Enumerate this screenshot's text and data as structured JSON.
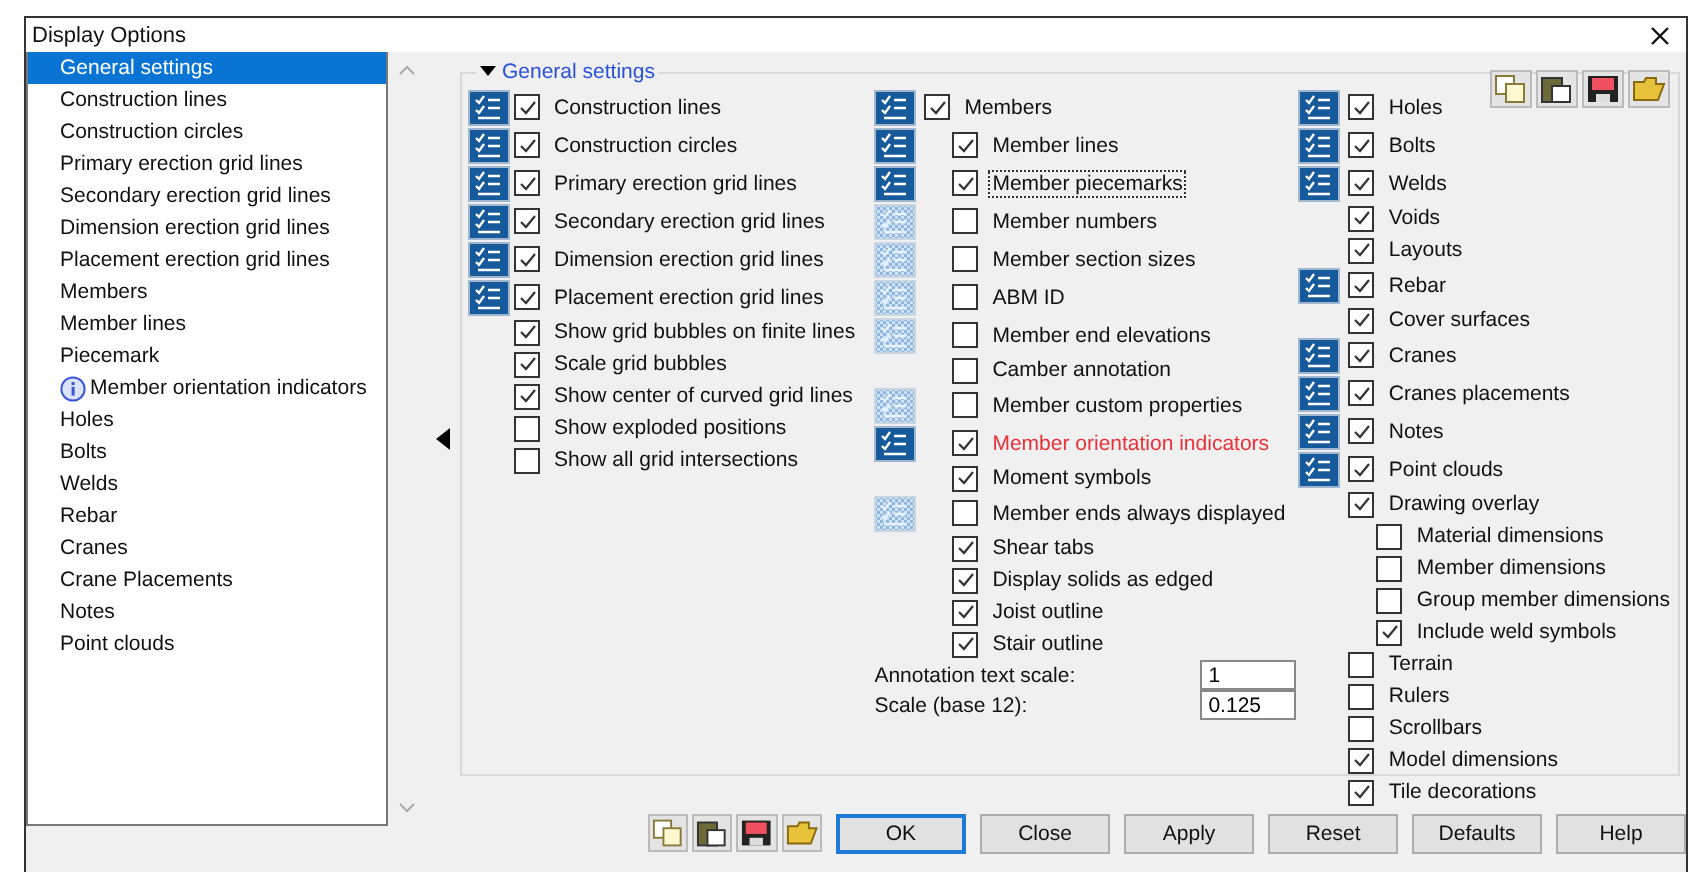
{
  "window": {
    "title": "Display Options"
  },
  "sidebar": {
    "items": [
      {
        "label": "General settings",
        "selected": true,
        "kind": "plain"
      },
      {
        "label": "Construction lines",
        "selected": false,
        "kind": "plain"
      },
      {
        "label": "Construction circles",
        "selected": false,
        "kind": "plain"
      },
      {
        "label": "Primary erection grid lines",
        "selected": false,
        "kind": "plain"
      },
      {
        "label": "Secondary erection grid lines",
        "selected": false,
        "kind": "plain"
      },
      {
        "label": "Dimension erection grid lines",
        "selected": false,
        "kind": "plain"
      },
      {
        "label": "Placement erection grid lines",
        "selected": false,
        "kind": "plain"
      },
      {
        "label": "Members",
        "selected": false,
        "kind": "plain"
      },
      {
        "label": "Member lines",
        "selected": false,
        "kind": "plain"
      },
      {
        "label": "Piecemark",
        "selected": false,
        "kind": "plain"
      },
      {
        "label": "Member orientation indicators",
        "selected": false,
        "kind": "info"
      },
      {
        "label": "Holes",
        "selected": false,
        "kind": "plain"
      },
      {
        "label": "Bolts",
        "selected": false,
        "kind": "plain"
      },
      {
        "label": "Welds",
        "selected": false,
        "kind": "plain"
      },
      {
        "label": "Rebar",
        "selected": false,
        "kind": "plain"
      },
      {
        "label": "Cranes",
        "selected": false,
        "kind": "plain"
      },
      {
        "label": "Crane Placements",
        "selected": false,
        "kind": "plain"
      },
      {
        "label": "Notes",
        "selected": false,
        "kind": "plain"
      },
      {
        "label": "Point clouds",
        "selected": false,
        "kind": "plain"
      }
    ]
  },
  "panel": {
    "title": "General settings",
    "expanded": true,
    "columns": [
      {
        "options": [
          {
            "label": "Construction lines",
            "checked": true,
            "kind": "toggle",
            "toggle_on": true
          },
          {
            "label": "Construction circles",
            "checked": true,
            "kind": "toggle",
            "toggle_on": true
          },
          {
            "label": "Primary erection grid lines",
            "checked": true,
            "kind": "toggle",
            "toggle_on": true
          },
          {
            "label": "Secondary erection grid lines",
            "checked": true,
            "kind": "toggle",
            "toggle_on": true
          },
          {
            "label": "Dimension erection grid lines",
            "checked": true,
            "kind": "toggle",
            "toggle_on": true
          },
          {
            "label": "Placement erection grid lines",
            "checked": true,
            "kind": "toggle",
            "toggle_on": true
          },
          {
            "label": "Show grid bubbles on finite lines",
            "checked": true
          },
          {
            "label": "Scale grid bubbles",
            "checked": true
          },
          {
            "label": "Show center of curved grid lines",
            "checked": true
          },
          {
            "label": "Show exploded positions",
            "checked": false
          },
          {
            "label": "Show all grid intersections",
            "checked": false
          }
        ]
      },
      {
        "options": [
          {
            "label": "Members",
            "checked": true,
            "kind": "toggle",
            "toggle_on": true,
            "children": [
              {
                "label": "Member lines",
                "checked": true,
                "kind": "toggle",
                "toggle_on": true
              },
              {
                "label": "Member piecemarks",
                "checked": true,
                "kind": "toggle",
                "toggle_on": true,
                "focused": true
              },
              {
                "label": "Member numbers",
                "checked": false,
                "kind": "toggle",
                "toggle_on": false
              },
              {
                "label": "Member section sizes",
                "checked": false,
                "kind": "toggle",
                "toggle_on": false
              },
              {
                "label": "ABM ID",
                "checked": false,
                "kind": "toggle",
                "toggle_on": false
              },
              {
                "label": "Member end elevations",
                "checked": false,
                "kind": "toggle",
                "toggle_on": false
              },
              {
                "label": "Camber annotation",
                "checked": false
              },
              {
                "label": "Member custom properties",
                "checked": false,
                "kind": "toggle",
                "toggle_on": false
              },
              {
                "label": "Member orientation indicators",
                "checked": true,
                "kind": "toggle",
                "toggle_on": true,
                "highlighted": true
              },
              {
                "label": "Moment symbols",
                "checked": true
              },
              {
                "label": "Member ends always displayed",
                "checked": false,
                "kind": "toggle",
                "toggle_on": false
              },
              {
                "label": "Shear tabs",
                "checked": true
              },
              {
                "label": "Display solids as edged",
                "checked": true
              },
              {
                "label": "Joist outline",
                "checked": true
              },
              {
                "label": "Stair outline",
                "checked": true
              }
            ]
          }
        ],
        "fields": [
          {
            "label": "Annotation text scale:",
            "value": "1"
          },
          {
            "label": "Scale (base 12):",
            "value": "0.125"
          }
        ]
      },
      {
        "options": [
          {
            "label": "Holes",
            "checked": true,
            "kind": "toggle",
            "toggle_on": true
          },
          {
            "label": "Bolts",
            "checked": true,
            "kind": "toggle",
            "toggle_on": true
          },
          {
            "label": "Welds",
            "checked": true,
            "kind": "toggle",
            "toggle_on": true
          },
          {
            "label": "Voids",
            "checked": true
          },
          {
            "label": "Layouts",
            "checked": true
          },
          {
            "label": "Rebar",
            "checked": true,
            "kind": "toggle",
            "toggle_on": true
          },
          {
            "label": "Cover surfaces",
            "checked": true
          },
          {
            "label": "Cranes",
            "checked": true,
            "kind": "toggle",
            "toggle_on": true
          },
          {
            "label": "Cranes placements",
            "checked": true,
            "kind": "toggle",
            "toggle_on": true
          },
          {
            "label": "Notes",
            "checked": true,
            "kind": "toggle",
            "toggle_on": true
          },
          {
            "label": "Point clouds",
            "checked": true,
            "kind": "toggle",
            "toggle_on": true
          },
          {
            "label": "Drawing overlay",
            "checked": true,
            "children": [
              {
                "label": "Material dimensions",
                "checked": false
              },
              {
                "label": "Member dimensions",
                "checked": false
              },
              {
                "label": "Group member dimensions",
                "checked": false
              },
              {
                "label": "Include weld symbols",
                "checked": true
              }
            ]
          },
          {
            "label": "Terrain",
            "checked": false
          },
          {
            "label": "Rulers",
            "checked": false
          },
          {
            "label": "Scrollbars",
            "checked": false
          },
          {
            "label": "Model dimensions",
            "checked": true
          },
          {
            "label": "Tile decorations",
            "checked": true
          }
        ]
      }
    ]
  },
  "buttons": [
    {
      "label": "OK",
      "default": true
    },
    {
      "label": "Close",
      "default": false
    },
    {
      "label": "Apply",
      "default": false
    },
    {
      "label": "Reset",
      "default": false
    },
    {
      "label": "Defaults",
      "default": false
    },
    {
      "label": "Help",
      "default": false
    }
  ]
}
